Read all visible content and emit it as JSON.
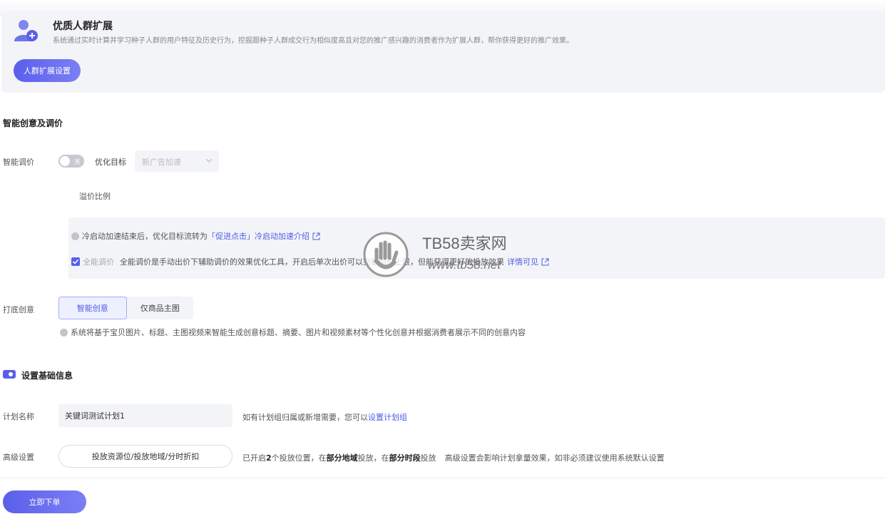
{
  "banner": {
    "title": "优质人群扩展",
    "description": "系统通过实时计算并学习种子人群的用户特征及历史行为，挖掘跟种子人群成交行为相似度高且对您的推广感兴趣的消费者作为扩展人群，帮你获得更好的推广效果。",
    "button": "人群扩展设置"
  },
  "smart": {
    "section_title": "智能创意及调价",
    "bid_label": "智能调价",
    "toggle_text": "关",
    "goal_label": "优化目标",
    "goal_value": "新广告加速",
    "premium_label": "溢价比例",
    "info1_text": "冷启动加速结束后，优化目标流转为",
    "info1_link": "「促进点击」冷启动加速介绍",
    "info2_check_label": "全能调价",
    "info2_text": "全能调价是手动出价下辅助调价的效果优化工具，开启后单次出价可以突破溢价上限，但能获得更好的投放效果",
    "info2_link": "详情可见",
    "creative_label": "打底创意",
    "creative_options": [
      "智能创意",
      "仅商品主图"
    ],
    "creative_hint": "系统将基于宝贝图片、标题、主图视频来智能生成创意标题、摘要、图片和视频素材等个性化创意并根据消费者展示不同的创意内容"
  },
  "basic": {
    "section_title": "设置基础信息",
    "plan_label": "计划名称",
    "plan_value": "关键词测试计划1",
    "plan_hint_prefix": "如有计划组归属或新增需要，您可以",
    "plan_hint_link": "设置计划组",
    "adv_label": "高级设置",
    "adv_button": "投放资源位/投放地域/分时折扣",
    "adv_text_1": "已开启",
    "adv_count": "2",
    "adv_text_2": "个投放位置，在",
    "adv_region": "部分地域",
    "adv_text_3": "投放，在",
    "adv_time": "部分时段",
    "adv_text_4": "投放",
    "adv_note": "高级设置会影响计划拿量效果，如非必须建议使用系统默认设置"
  },
  "submit_button": "立即下单",
  "watermark": {
    "title": "TB58卖家网",
    "url": "www.tb58.net"
  },
  "colors": {
    "primary": "#5a5fea",
    "link": "#4e5ce9",
    "panel_bg": "#f3f4f7"
  }
}
